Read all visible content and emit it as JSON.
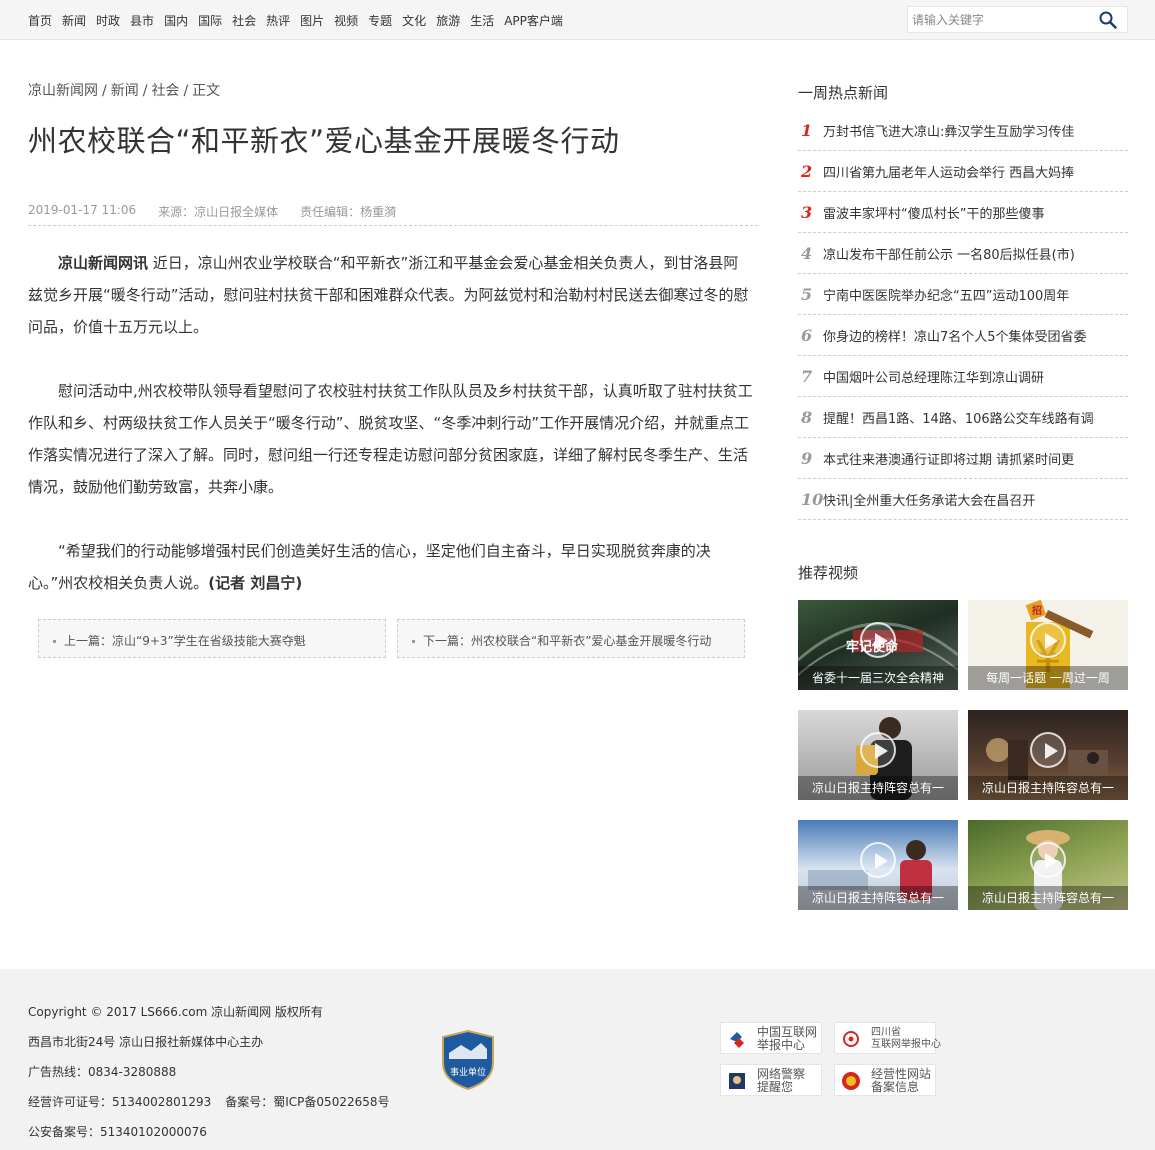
{
  "nav": {
    "items": [
      "首页",
      "新闻",
      "时政",
      "县市",
      "国内",
      "国际",
      "社会",
      "热评",
      "图片",
      "视频",
      "专题",
      "文化",
      "旅游",
      "生活",
      "APP客户端"
    ]
  },
  "search": {
    "placeholder": "请输入关键字",
    "icon": "search-icon"
  },
  "breadcrumb": [
    "凉山新闻网",
    "/",
    "新闻",
    "/",
    "社会",
    "/",
    "正文"
  ],
  "article": {
    "title": "州农校联合“和平新衣”爱心基金开展暖冬行动",
    "date": "2019-01-17 11:06",
    "source": "来源：凉山日报全媒体",
    "editor": "责任编辑：杨重漪",
    "para1_lead": "凉山新闻网讯",
    "para1_body": " 近日，凉山州农业学校联合“和平新衣”浙江和平基金会爱心基金相关负责人，到甘洛县阿兹觉乡开展“暖冬行动”活动，慰问驻村扶贫干部和困难群众代表。为阿兹觉村和治勒村村民送去御寒过冬的慰问品，价值十五万元以上。",
    "para2": "慰问活动中,州农校带队领导看望慰问了农校驻村扶贫工作队队员及乡村扶贫干部，认真听取了驻村扶贫工作队和乡、村两级扶贫工作人员关于“暖冬行动”、脱贫攻坚、“冬季冲刺行动”工作开展情况介绍，并就重点工作落实情况进行了深入了解。同时，慰问组一行还专程走访慰问部分贫困家庭，详细了解村民冬季生产、生活情况，鼓励他们勤劳致富，共奔小康。",
    "para3_body": "“希望我们的行动能够增强村民们创造美好生活的信心，坚定他们自主奋斗，早日实现脱贫奔康的决心。”州农校相关负责人说。",
    "para3_author": "(记者 刘昌宁)"
  },
  "prevnext": {
    "prev": "上一篇：凉山“9+3”学生在省级技能大赛夺魁",
    "next": "下一篇：州农校联合“和平新衣”爱心基金开展暖冬行动"
  },
  "sidebar": {
    "hot_title": "一周热点新闻",
    "hot": [
      {
        "num": "1",
        "text": "万封书信飞进大凉山:彝汉学生互励学习传佳"
      },
      {
        "num": "2",
        "text": "四川省第九届老年人运动会举行 西昌大妈捧"
      },
      {
        "num": "3",
        "text": "雷波丰家坪村“傻瓜村长”干的那些傻事"
      },
      {
        "num": "4",
        "text": "凉山发布干部任前公示 一名80后拟任县(市)"
      },
      {
        "num": "5",
        "text": "宁南中医医院举办纪念“五四”运动100周年"
      },
      {
        "num": "6",
        "text": "你身边的榜样！凉山7名个人5个集体受团省委"
      },
      {
        "num": "7",
        "text": "中国烟叶公司总经理陈江华到凉山调研"
      },
      {
        "num": "8",
        "text": "提醒！西昌1路、14路、106路公交车线路有调"
      },
      {
        "num": "9",
        "text": "本式往来港澳通行证即将过期 请抓紧时间更"
      },
      {
        "num": "10",
        "text": "快讯|全州重大任务承诺大会在昌召开"
      }
    ],
    "video_title": "推荐视频",
    "videos": [
      {
        "caption": "省委十一届三次全会精神",
        "overlay": "牢记使命"
      },
      {
        "caption": "每周一话题 一周过一周",
        "overlay": "招"
      },
      {
        "caption": "凉山日报主持阵容总有一",
        "overlay": ""
      },
      {
        "caption": "凉山日报主持阵容总有一",
        "overlay": ""
      },
      {
        "caption": "凉山日报主持阵容总有一",
        "overlay": ""
      },
      {
        "caption": "凉山日报主持阵容总有一",
        "overlay": ""
      }
    ]
  },
  "footer": {
    "copyright": "Copyright © 2017 LS666.com 凉山新闻网 版权所有",
    "host": "西昌市北街24号 凉山日报社新媒体中心主办",
    "ad_phone": "广告热线：0834-3280888",
    "license": "经营许可证号：5134002801293",
    "icp": "备案号：蜀ICP备05022658号",
    "police": "公安备案号：51340102000076",
    "badge_text": "事业单位",
    "links": [
      {
        "text": "中国互联网\n举报中心",
        "icon": "report-center-icon"
      },
      {
        "text": "四川省\n互联网举报中心",
        "icon": "sichuan-report-icon"
      },
      {
        "text": "网络警察\n提醒您",
        "icon": "cyber-police-icon"
      },
      {
        "text": "经营性网站\n备案信息",
        "icon": "website-record-icon"
      }
    ]
  },
  "colors": {
    "accent_red": "#d9261c",
    "nav_bg": "#f5f5f5",
    "footer_bg": "#f2f2f2"
  }
}
